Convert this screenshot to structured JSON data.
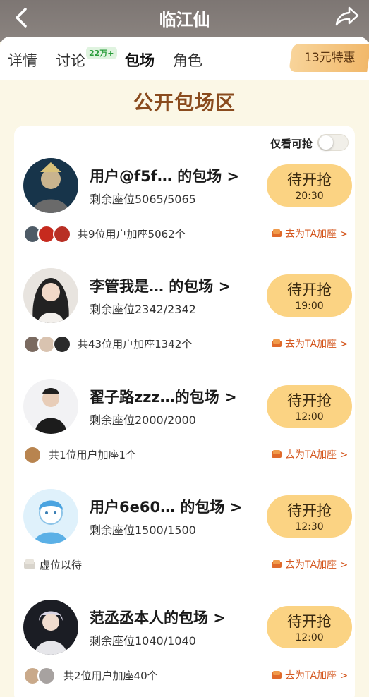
{
  "header": {
    "title": "临江仙"
  },
  "tabs": [
    {
      "label": "详情"
    },
    {
      "label": "讨论",
      "badge": "22万+"
    },
    {
      "label": "包场"
    },
    {
      "label": "角色"
    }
  ],
  "promo": {
    "label": "13元特惠"
  },
  "section_title": "公开包场区",
  "filter": {
    "label": "仅看可抢",
    "enabled": false
  },
  "entries": [
    {
      "name": "用户@f5f…  的包场 >",
      "seats": "剩余座位5065/5065",
      "button": "待开抢",
      "time": "20:30",
      "joined": "共9位用户加座5062个",
      "action": "去为TA加座 >"
    },
    {
      "name": "李管我是…  的包场 >",
      "seats": "剩余座位2342/2342",
      "button": "待开抢",
      "time": "19:00",
      "joined": "共43位用户加座1342个",
      "action": "去为TA加座 >"
    },
    {
      "name": "翟子路zzz…的包场 >",
      "seats": "剩余座位2000/2000",
      "button": "待开抢",
      "time": "12:00",
      "joined": "共1位用户加座1个",
      "action": "去为TA加座 >"
    },
    {
      "name": "用户6e60…  的包场 >",
      "seats": "剩余座位1500/1500",
      "button": "待开抢",
      "time": "12:30",
      "joined": "虚位以待",
      "action": "去为TA加座 >"
    },
    {
      "name": "范丞丞本人的包场 >",
      "seats": "剩余座位1040/1040",
      "button": "待开抢",
      "time": "12:00",
      "joined": "共2位用户加座40个",
      "action": "去为TA加座 >"
    }
  ],
  "colors": {
    "accent": "#d4571e",
    "button": "#fbd383",
    "section_title": "#8a4b1e",
    "background": "#fbf7e6"
  }
}
